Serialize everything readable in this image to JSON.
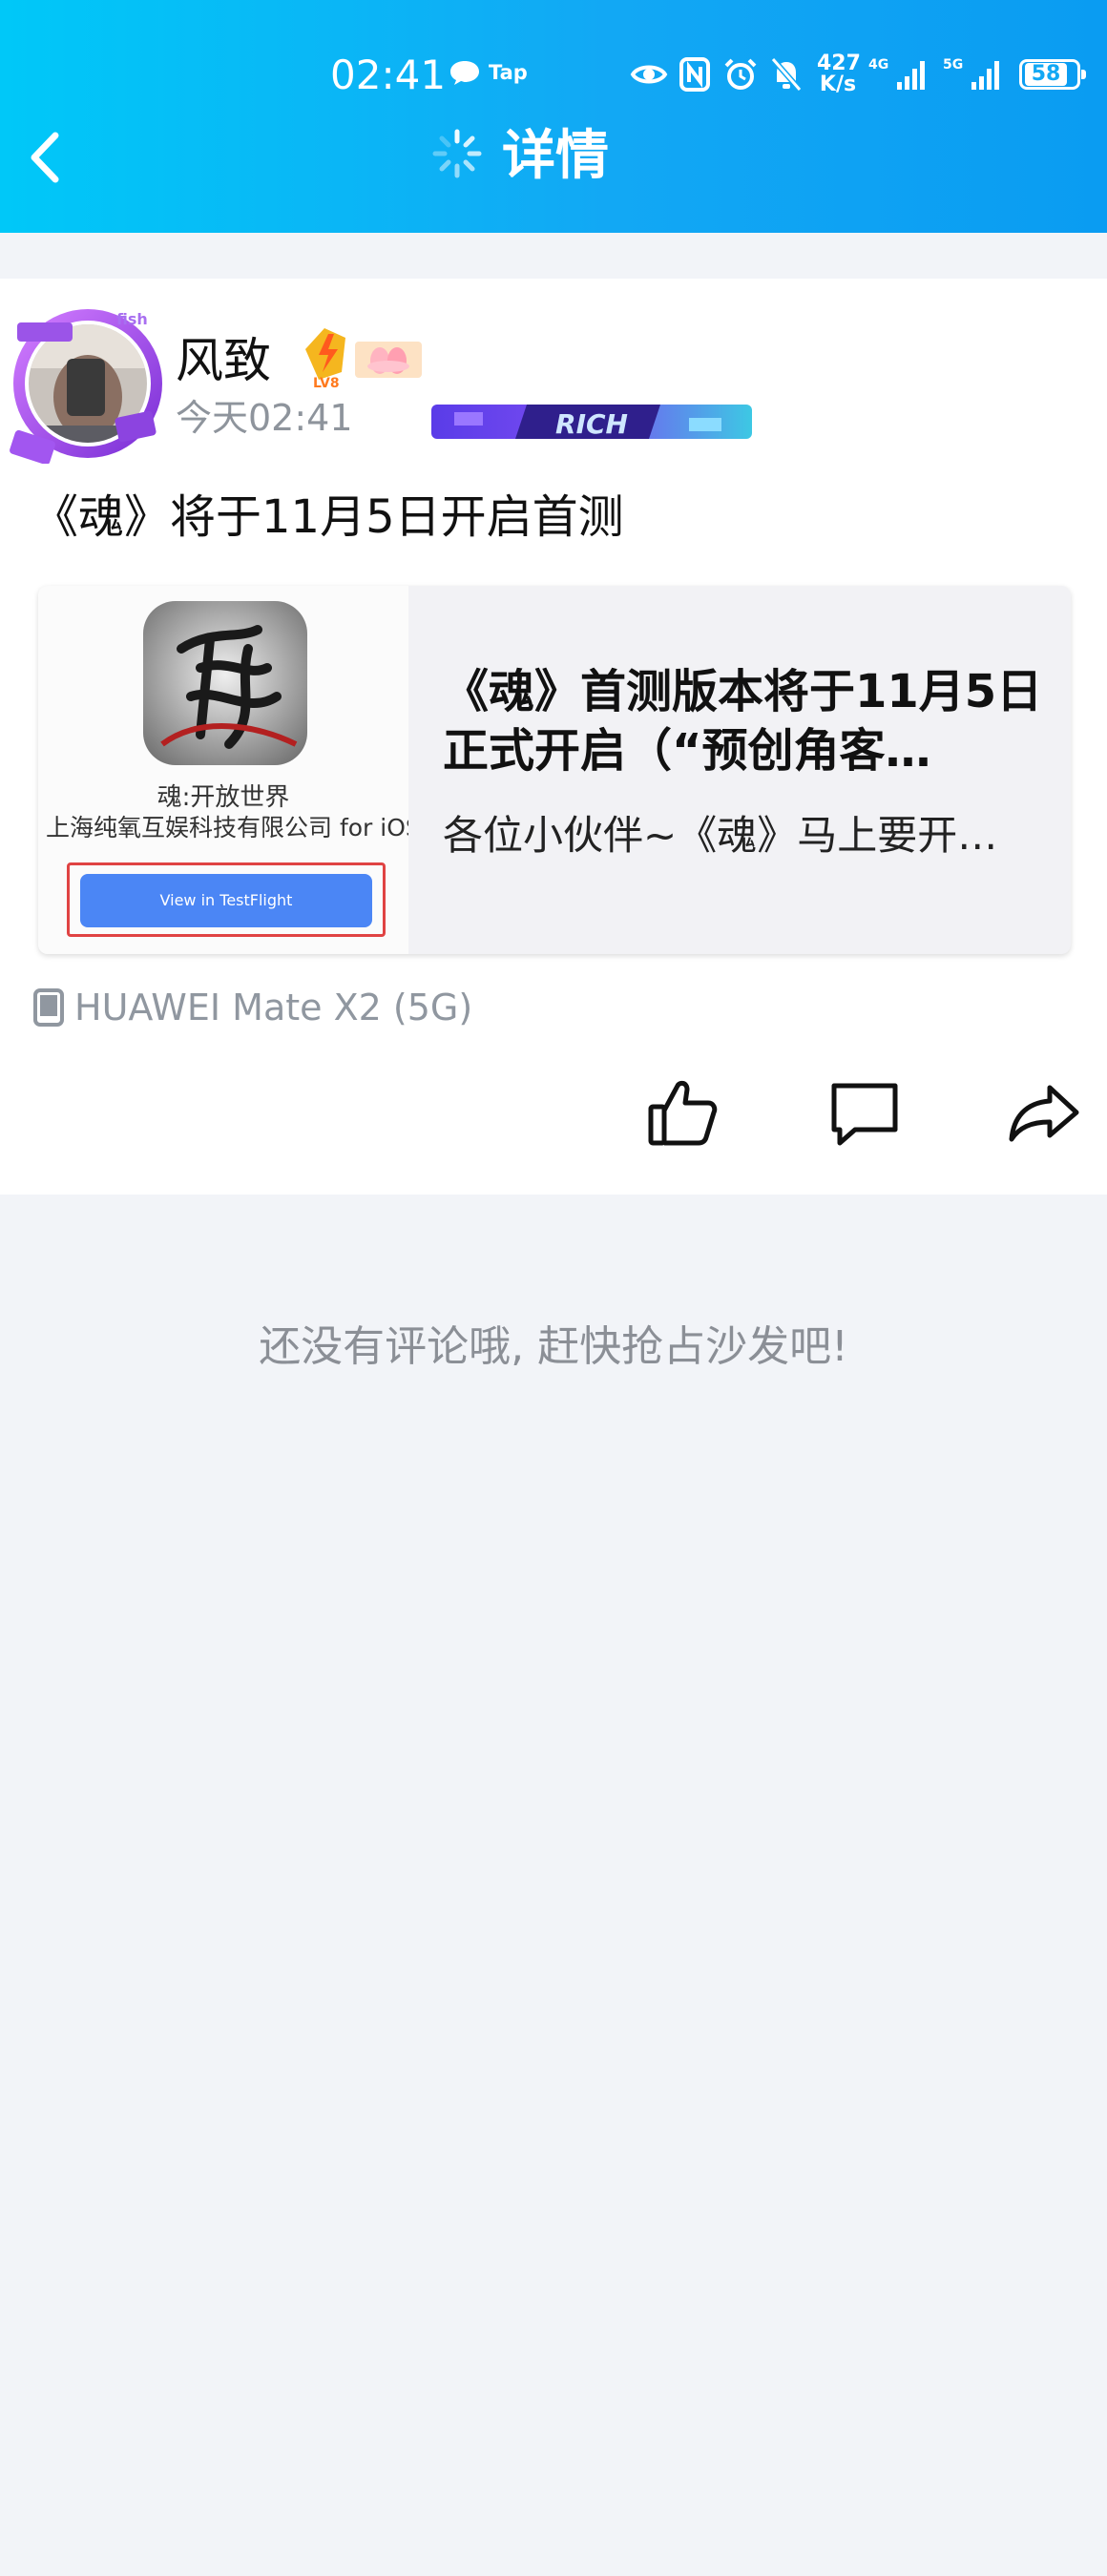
{
  "status_bar": {
    "time": "02:41",
    "app_label": "Tap",
    "net_speed_value": "427",
    "net_speed_unit": "K/s",
    "network_1": "4G",
    "network_2": "5G",
    "battery": "58"
  },
  "header": {
    "title": "详情",
    "back_icon": "chevron-left-icon",
    "gradient_start": "#00c8f8",
    "gradient_end": "#0a9cf2"
  },
  "post": {
    "author": "风致",
    "level": "LV8",
    "time": "今天02:41",
    "rich_badge": "RICH",
    "title": "《魂》将于11月5日开启首测",
    "link": {
      "headline": "《魂》首测版本将于11月5日正式开启（“预创角客…",
      "summary": "各位小伙伴~《魂》马上要开…",
      "thumb_title": "魂:开放世界",
      "thumb_company": "上海纯氧互娱科技有限公司 for iOS",
      "thumb_button": "View in TestFlight"
    },
    "device": "HUAWEI Mate X2 (5G)",
    "actions": [
      "like-icon",
      "comment-icon",
      "share-icon"
    ]
  },
  "comments": {
    "empty_text": "还没有评论哦, 赶快抢占沙发吧!"
  }
}
